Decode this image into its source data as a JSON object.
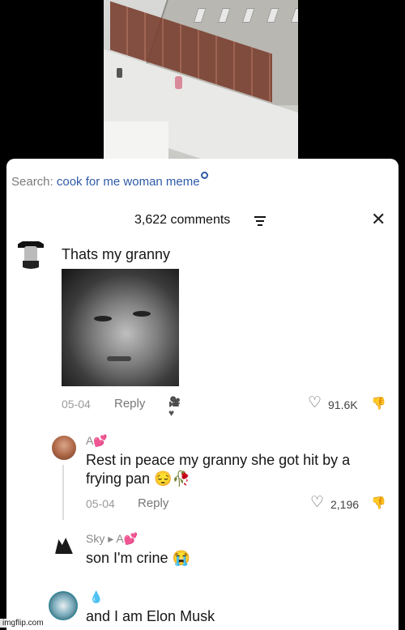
{
  "search": {
    "label": "Search:",
    "term": "cook for me woman meme"
  },
  "header": {
    "count": "3,622 comments"
  },
  "comments": [
    {
      "text": "Thats my granny",
      "date": "05-04",
      "reply": "Reply",
      "likes": "91.6K"
    },
    {
      "author": "A",
      "author_badge": "💕",
      "text_line1": "Rest in peace my granny she got hit by a",
      "text_line2": "frying pan 😔🥀",
      "date": "05-04",
      "reply": "Reply",
      "likes": "2,196"
    },
    {
      "author": "Sky",
      "reply_to": "A",
      "reply_to_badge": "💕",
      "text": "son I'm crine 😭"
    },
    {
      "author_badge": "💧",
      "text": "and I am Elon Musk"
    }
  ],
  "watermark": "imgflip.com"
}
